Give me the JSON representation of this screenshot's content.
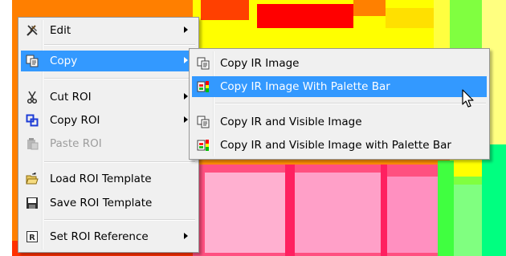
{
  "context_menu": {
    "items": [
      {
        "label": "Edit",
        "icon": "tools-icon",
        "submenu": true
      },
      {
        "label": "Copy",
        "icon": "copy-icon",
        "submenu": true,
        "highlighted": true
      },
      {
        "label": "Cut ROI",
        "icon": "scissors-icon",
        "submenu": true
      },
      {
        "label": "Copy ROI",
        "icon": "copy-roi-icon",
        "submenu": true
      },
      {
        "label": "Paste ROI",
        "icon": "paste-icon",
        "submenu": false,
        "disabled": true
      },
      {
        "label": "Load ROI Template",
        "icon": "open-folder-icon",
        "submenu": false
      },
      {
        "label": "Save ROI Template",
        "icon": "save-icon",
        "submenu": false
      },
      {
        "label": "Set ROI Reference",
        "icon": "reference-icon",
        "submenu": true
      }
    ]
  },
  "copy_submenu": {
    "items": [
      {
        "label": "Copy IR Image",
        "icon": "copy-icon"
      },
      {
        "label": "Copy IR Image With Palette Bar",
        "icon": "palette-bar-icon",
        "highlighted": true
      },
      {
        "label": "Copy IR and Visible Image",
        "icon": "copy-icon"
      },
      {
        "label": "Copy IR and Visible Image with Palette Bar",
        "icon": "palette-bar-icon"
      }
    ]
  },
  "colors": {
    "menu_background": "#f0f0f0",
    "highlight": "#3399ff",
    "disabled_text": "#9d9d9d",
    "thermal_palette": [
      "#ff0000",
      "#ff8000",
      "#ffff00",
      "#80ff00",
      "#00ff80",
      "#ffc0e0"
    ]
  }
}
